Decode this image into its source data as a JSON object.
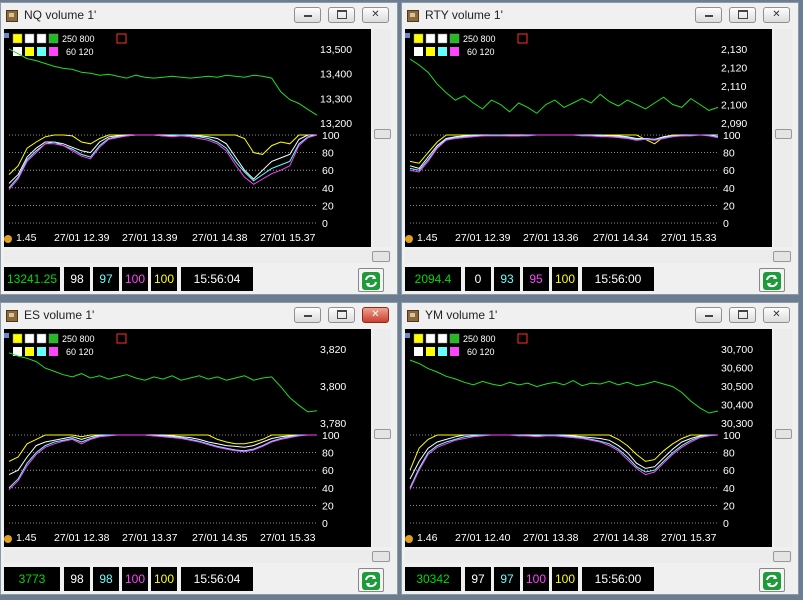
{
  "colors": {
    "price": "#22dd22",
    "yellow": "#ffff00",
    "white": "#ffffff",
    "cyan": "#66ffff",
    "magenta": "#ff44ff",
    "price_text": "#00dd00"
  },
  "windows": [
    {
      "title": "NQ volume 1'",
      "close_active": false,
      "legend": {
        "row1": "250  800",
        "row2": "60  120"
      },
      "right_ticks": [
        "13,500",
        "13,400",
        "13,300",
        "13,200"
      ],
      "osc_ticks": [
        "100",
        "80",
        "60",
        "40",
        "20",
        "0"
      ],
      "time_labels": [
        "1.45",
        "27/01 12.39",
        "27/01 13.39",
        "27/01 14.38",
        "27/01 15.37"
      ],
      "status": {
        "price": "13241.25",
        "v1": "98",
        "v2": "97",
        "v3": "100",
        "v4": "100",
        "time": "15:56:04"
      },
      "chart_data": {
        "type": "line",
        "price_range": [
          13140,
          13560
        ],
        "price": [
          13530,
          13505,
          13480,
          13470,
          13455,
          13440,
          13430,
          13425,
          13410,
          13405,
          13395,
          13400,
          13390,
          13380,
          13395,
          13385,
          13380,
          13385,
          13390,
          13385,
          13380,
          13385,
          13390,
          13385,
          13395,
          13390,
          13385,
          13395,
          13390,
          13380,
          13310,
          13270,
          13250,
          13220,
          13190
        ],
        "oscillator_range": [
          0,
          100
        ],
        "series_yellow": [
          55,
          65,
          85,
          92,
          98,
          100,
          100,
          99,
          92,
          90,
          96,
          100,
          100,
          100,
          100,
          100,
          100,
          100,
          100,
          100,
          100,
          100,
          100,
          100,
          100,
          100,
          96,
          80,
          78,
          88,
          92,
          90,
          100,
          100,
          100
        ],
        "series_white": [
          45,
          55,
          75,
          85,
          92,
          92,
          90,
          86,
          82,
          80,
          92,
          98,
          99,
          100,
          100,
          100,
          100,
          100,
          100,
          100,
          100,
          99,
          98,
          96,
          90,
          75,
          60,
          50,
          60,
          70,
          74,
          78,
          95,
          100,
          100
        ],
        "series_cyan": [
          40,
          52,
          72,
          82,
          90,
          92,
          88,
          84,
          78,
          75,
          88,
          96,
          98,
          99,
          100,
          100,
          100,
          99,
          99,
          100,
          99,
          98,
          96,
          92,
          85,
          70,
          58,
          48,
          55,
          62,
          66,
          70,
          90,
          98,
          100
        ],
        "series_magenta": [
          38,
          50,
          70,
          80,
          90,
          90,
          88,
          82,
          76,
          73,
          86,
          95,
          97,
          99,
          100,
          100,
          100,
          99,
          98,
          99,
          98,
          96,
          94,
          90,
          82,
          66,
          52,
          44,
          50,
          56,
          60,
          65,
          88,
          97,
          100
        ]
      }
    },
    {
      "title": "RTY volume 1'",
      "close_active": false,
      "legend": {
        "row1": "250  800",
        "row2": "60  120"
      },
      "right_ticks": [
        "2,130",
        "2,120",
        "2,110",
        "2,100",
        "2,090"
      ],
      "osc_ticks": [
        "100",
        "80",
        "60",
        "40",
        "20",
        "0"
      ],
      "time_labels": [
        "1.45",
        "27/01 12.39",
        "27/01 13.36",
        "27/01 14.34",
        "27/01 15.33"
      ],
      "status": {
        "price": "2094.4",
        "v1": "0",
        "v2": "93",
        "v3": "95",
        "v4": "100",
        "time": "15:56:00"
      },
      "chart_data": {
        "type": "line",
        "price_range": [
          2082,
          2138
        ],
        "price": [
          2127,
          2123,
          2118,
          2110,
          2104,
          2099,
          2102,
          2097,
          2093,
          2099,
          2096,
          2091,
          2097,
          2094,
          2090,
          2096,
          2099,
          2094,
          2097,
          2100,
          2097,
          2103,
          2098,
          2095,
          2099,
          2096,
          2093,
          2097,
          2101,
          2096,
          2094,
          2100,
          2096,
          2092,
          2094
        ],
        "oscillator_range": [
          0,
          100
        ],
        "series_yellow": [
          70,
          68,
          80,
          92,
          100,
          100,
          100,
          100,
          100,
          100,
          100,
          100,
          100,
          100,
          100,
          100,
          100,
          100,
          100,
          100,
          100,
          100,
          100,
          100,
          100,
          100,
          95,
          90,
          98,
          100,
          100,
          100,
          100,
          100,
          100
        ],
        "series_white": [
          65,
          62,
          75,
          88,
          96,
          98,
          99,
          100,
          100,
          100,
          100,
          100,
          100,
          100,
          100,
          100,
          100,
          100,
          100,
          100,
          100,
          100,
          99,
          99,
          98,
          96,
          96,
          95,
          98,
          99,
          100,
          100,
          100,
          100,
          100
        ],
        "series_cyan": [
          62,
          60,
          72,
          86,
          95,
          97,
          98,
          99,
          99,
          100,
          100,
          99,
          99,
          100,
          100,
          100,
          100,
          100,
          100,
          100,
          99,
          99,
          98,
          98,
          97,
          95,
          96,
          95,
          97,
          99,
          99,
          100,
          100,
          100,
          98
        ],
        "series_magenta": [
          60,
          58,
          70,
          85,
          94,
          96,
          97,
          98,
          99,
          99,
          99,
          99,
          99,
          99,
          100,
          100,
          100,
          100,
          100,
          99,
          99,
          98,
          98,
          97,
          96,
          94,
          95,
          94,
          96,
          98,
          99,
          99,
          100,
          99,
          97
        ]
      }
    },
    {
      "title": "ES volume 1'",
      "close_active": true,
      "legend": {
        "row1": "250  800",
        "row2": "60  120"
      },
      "right_ticks": [
        "3,820",
        "3,800",
        "3,780"
      ],
      "osc_ticks": [
        "100",
        "80",
        "60",
        "40",
        "20",
        "0"
      ],
      "time_labels": [
        "1.45",
        "27/01 12.38",
        "27/01 13.37",
        "27/01 14.35",
        "27/01 15.33"
      ],
      "status": {
        "price": "3773",
        "v1": "98",
        "v2": "98",
        "v3": "100",
        "v4": "100",
        "time": "15:56:04"
      },
      "chart_data": {
        "type": "line",
        "price_range": [
          3760,
          3835
        ],
        "price": [
          3826,
          3823,
          3821,
          3818,
          3812,
          3809,
          3806,
          3804,
          3807,
          3803,
          3805,
          3802,
          3804,
          3806,
          3803,
          3801,
          3804,
          3802,
          3805,
          3801,
          3803,
          3805,
          3802,
          3804,
          3801,
          3803,
          3805,
          3801,
          3803,
          3804,
          3795,
          3785,
          3778,
          3772,
          3773
        ],
        "oscillator_range": [
          0,
          100
        ],
        "series_yellow": [
          70,
          75,
          90,
          95,
          100,
          100,
          100,
          100,
          98,
          100,
          100,
          100,
          100,
          100,
          100,
          100,
          100,
          100,
          100,
          100,
          100,
          100,
          100,
          95,
          92,
          90,
          90,
          92,
          95,
          100,
          100,
          100,
          100,
          100,
          100
        ],
        "series_white": [
          55,
          60,
          75,
          88,
          92,
          94,
          96,
          98,
          95,
          98,
          100,
          100,
          100,
          100,
          100,
          100,
          100,
          100,
          99,
          98,
          97,
          95,
          92,
          90,
          88,
          87,
          86,
          88,
          92,
          96,
          98,
          99,
          100,
          100,
          100
        ],
        "series_cyan": [
          40,
          50,
          68,
          80,
          88,
          92,
          94,
          96,
          92,
          96,
          99,
          100,
          100,
          100,
          100,
          100,
          99,
          99,
          98,
          97,
          95,
          93,
          90,
          87,
          85,
          83,
          82,
          84,
          88,
          93,
          96,
          98,
          100,
          100,
          100
        ],
        "series_magenta": [
          38,
          48,
          65,
          78,
          86,
          90,
          93,
          95,
          90,
          95,
          98,
          99,
          100,
          100,
          100,
          100,
          99,
          98,
          97,
          96,
          94,
          92,
          89,
          86,
          84,
          82,
          81,
          83,
          87,
          92,
          95,
          97,
          99,
          100,
          100
        ]
      }
    },
    {
      "title": "YM volume 1'",
      "close_active": false,
      "legend": {
        "row1": "250  800",
        "row2": "60  120"
      },
      "right_ticks": [
        "30,700",
        "30,600",
        "30,500",
        "30,400",
        "30,300"
      ],
      "osc_ticks": [
        "100",
        "80",
        "60",
        "40",
        "20",
        "0"
      ],
      "time_labels": [
        "1.46",
        "27/01 12.40",
        "27/01 13.38",
        "27/01 14.38",
        "27/01 15.37"
      ],
      "status": {
        "price": "30342",
        "v1": "97",
        "v2": "97",
        "v3": "100",
        "v4": "100",
        "time": "15:56:00"
      },
      "chart_data": {
        "type": "line",
        "price_range": [
          30260,
          30740
        ],
        "price": [
          30640,
          30620,
          30590,
          30570,
          30545,
          30530,
          30510,
          30495,
          30515,
          30500,
          30490,
          30510,
          30495,
          30505,
          30485,
          30500,
          30510,
          30495,
          30520,
          30490,
          30505,
          30500,
          30515,
          30495,
          30510,
          30490,
          30500,
          30515,
          30500,
          30485,
          30450,
          30400,
          30360,
          30330,
          30342
        ],
        "oscillator_range": [
          0,
          100
        ],
        "series_yellow": [
          60,
          85,
          95,
          100,
          100,
          100,
          100,
          100,
          100,
          100,
          100,
          100,
          100,
          100,
          100,
          100,
          100,
          100,
          100,
          100,
          100,
          100,
          100,
          95,
          88,
          78,
          70,
          72,
          82,
          90,
          96,
          100,
          100,
          100,
          100
        ],
        "series_white": [
          50,
          70,
          85,
          92,
          95,
          98,
          100,
          100,
          100,
          100,
          100,
          100,
          100,
          100,
          100,
          100,
          100,
          100,
          99,
          98,
          97,
          96,
          94,
          88,
          80,
          68,
          62,
          64,
          74,
          84,
          92,
          96,
          99,
          100,
          100
        ],
        "series_cyan": [
          40,
          62,
          80,
          88,
          92,
          95,
          98,
          99,
          100,
          100,
          100,
          100,
          100,
          99,
          99,
          100,
          100,
          99,
          98,
          97,
          95,
          93,
          90,
          84,
          75,
          64,
          58,
          60,
          70,
          80,
          88,
          94,
          98,
          100,
          100
        ],
        "series_magenta": [
          38,
          60,
          78,
          86,
          90,
          94,
          96,
          98,
          99,
          100,
          100,
          100,
          99,
          99,
          98,
          99,
          99,
          98,
          97,
          96,
          94,
          92,
          88,
          82,
          72,
          62,
          55,
          58,
          68,
          78,
          86,
          92,
          97,
          99,
          100
        ]
      }
    }
  ]
}
